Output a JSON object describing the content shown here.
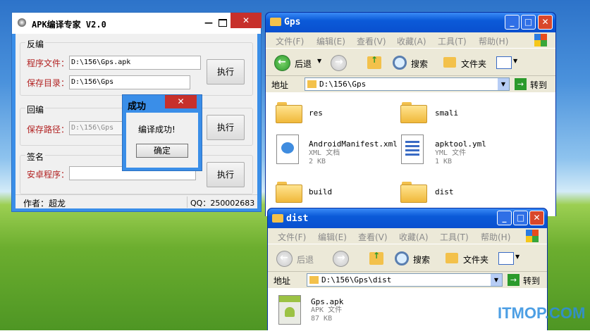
{
  "apk_tool": {
    "title": "APK编译专家  V2.0",
    "decompile": {
      "group": "反编",
      "program_label": "程序文件：",
      "program_value": "D:\\156\\Gps.apk",
      "save_label": "保存目录：",
      "save_value": "D:\\156\\Gps",
      "execute": "执行"
    },
    "recompile": {
      "group": "回编",
      "save_path_label": "保存路径：",
      "save_path_value": "D:\\156\\Gps",
      "execute": "执行"
    },
    "sign": {
      "group": "签名",
      "install_label": "安卓程序：",
      "install_value": "",
      "execute": "执行"
    },
    "status": {
      "author": "作者：超龙",
      "qq": "QQ：250002683"
    },
    "close_glyph": "✕",
    "minimize_glyph": "—"
  },
  "dialog": {
    "title": "成功",
    "message": "编译成功!",
    "ok": "确定",
    "close_glyph": "✕"
  },
  "explorer_gps": {
    "title": "Gps",
    "menu": [
      "文件(F)",
      "编辑(E)",
      "查看(V)",
      "收藏(A)",
      "工具(T)",
      "帮助(H)"
    ],
    "back": "后退",
    "search": "搜索",
    "folders_btn": "文件夹",
    "address_label": "地址",
    "address": "D:\\156\\Gps",
    "go": "转到",
    "items": [
      {
        "name": "res",
        "kind": "folder"
      },
      {
        "name": "smali",
        "kind": "folder"
      },
      {
        "name": "AndroidManifest.xml",
        "type": "XML 文档",
        "size": "2 KB",
        "kind": "xml"
      },
      {
        "name": "apktool.yml",
        "type": "YML 文件",
        "size": "1 KB",
        "kind": "yml"
      },
      {
        "name": "build",
        "kind": "folder"
      },
      {
        "name": "dist",
        "kind": "folder"
      }
    ]
  },
  "explorer_dist": {
    "title": "dist",
    "menu": [
      "文件(F)",
      "编辑(E)",
      "查看(V)",
      "收藏(A)",
      "工具(T)",
      "帮助(H)"
    ],
    "back": "后退",
    "search": "搜索",
    "folders_btn": "文件夹",
    "address_label": "地址",
    "address": "D:\\156\\Gps\\dist",
    "go": "转到",
    "items": [
      {
        "name": "Gps.apk",
        "type": "APK 文件",
        "size": "87 KB",
        "kind": "apk"
      }
    ]
  },
  "watermark": "ITMOP.COM"
}
